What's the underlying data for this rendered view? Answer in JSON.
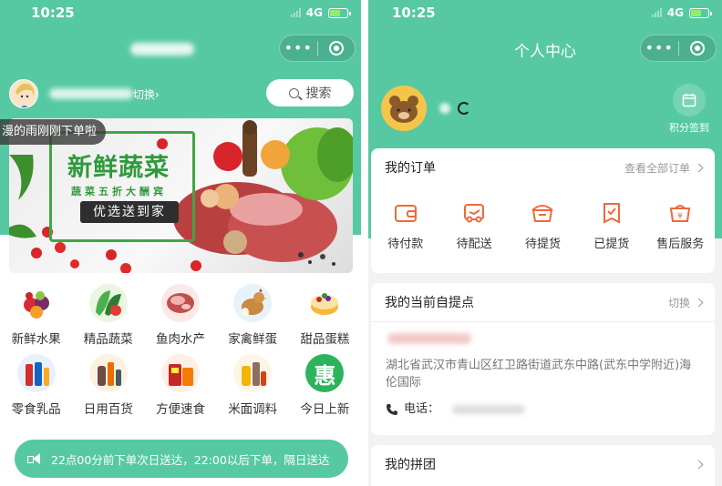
{
  "left": {
    "status": {
      "time": "10:25",
      "network": "4G"
    },
    "store": {
      "switch_label": "切换›"
    },
    "search": {
      "label": "搜索"
    },
    "marquee": {
      "text": "漫的雨刚刚下单啦"
    },
    "banner": {
      "title": "新鲜蔬菜",
      "subtitle": "蔬菜五折大酬宾",
      "cta": "优选送到家"
    },
    "categories": [
      {
        "label": "新鲜水果",
        "icon": "fruit-icon"
      },
      {
        "label": "精品蔬菜",
        "icon": "vegetable-icon"
      },
      {
        "label": "鱼肉水产",
        "icon": "meat-icon"
      },
      {
        "label": "家禽鲜蛋",
        "icon": "poultry-icon"
      },
      {
        "label": "甜品蛋糕",
        "icon": "cake-icon"
      },
      {
        "label": "零食乳品",
        "icon": "snack-icon"
      },
      {
        "label": "日用百货",
        "icon": "daily-goods-icon"
      },
      {
        "label": "方便速食",
        "icon": "instant-food-icon"
      },
      {
        "label": "米面调料",
        "icon": "rice-flour-icon"
      },
      {
        "label": "今日上新",
        "icon": "hui-icon",
        "badge": "惠"
      }
    ],
    "notice": {
      "text": "22点00分前下单次日送达，22:00以后下单，隔日送达"
    }
  },
  "right": {
    "status": {
      "time": "10:25",
      "network": "4G"
    },
    "title": "个人中心",
    "checkin_label": "积分签到",
    "orders": {
      "title": "我的订单",
      "view_all": "查看全部订单",
      "items": [
        {
          "label": "待付款",
          "icon": "wallet-icon"
        },
        {
          "label": "待配送",
          "icon": "delivery-icon"
        },
        {
          "label": "待提货",
          "icon": "pickup-box-icon"
        },
        {
          "label": "已提货",
          "icon": "picked-up-icon"
        },
        {
          "label": "售后服务",
          "icon": "after-sales-icon"
        }
      ]
    },
    "pickup": {
      "title": "我的当前自提点",
      "switch_label": "切换",
      "address": "湖北省武汉市青山区红卫路街道武东中路(武东中学附近)海伦国际",
      "phone_label": "电话："
    },
    "group": {
      "title": "我的拼团"
    }
  },
  "colors": {
    "accent": "#56c9a3",
    "orange": "#f0683b"
  }
}
